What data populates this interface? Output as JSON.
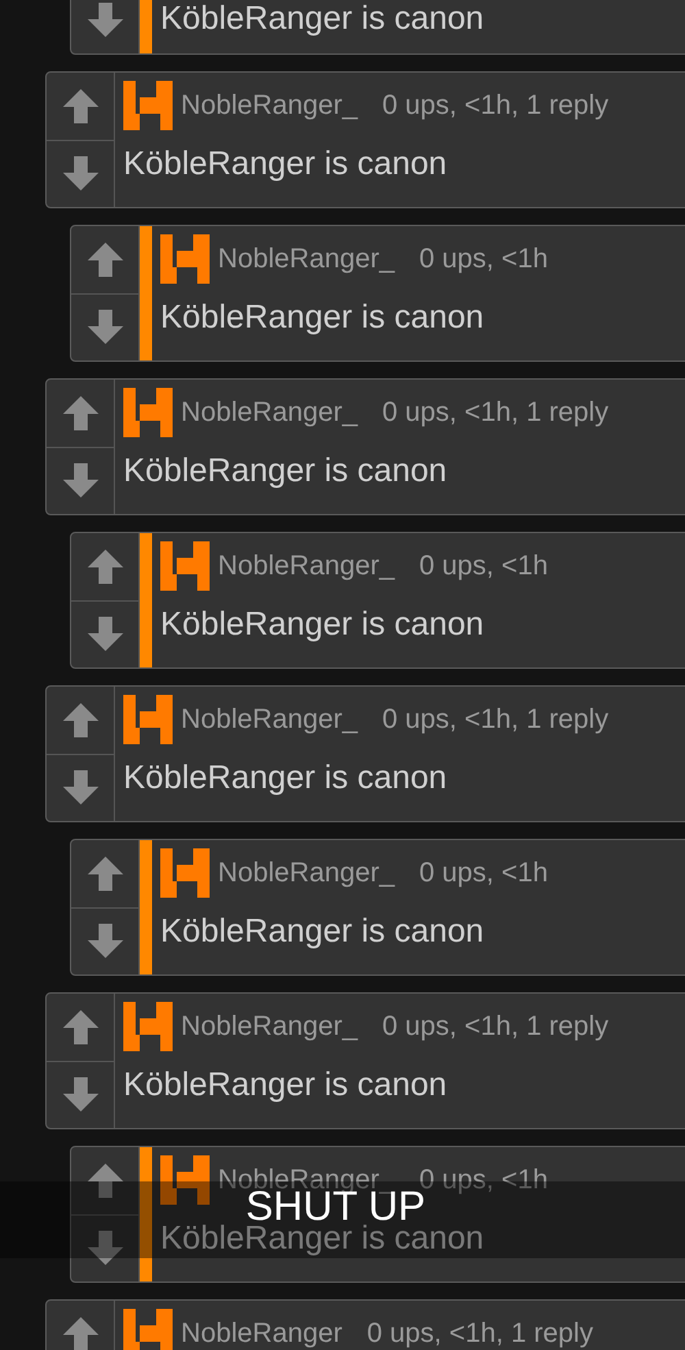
{
  "comments": [
    {
      "kind": "reply",
      "text": "KöbleRanger is canon"
    },
    {
      "kind": "root",
      "author": "NobleRanger_",
      "meta": "0 ups, <1h, 1 reply",
      "text": "KöbleRanger is canon"
    },
    {
      "kind": "reply",
      "author": "NobleRanger_",
      "meta": "0 ups, <1h",
      "text": "KöbleRanger is canon"
    },
    {
      "kind": "root",
      "author": "NobleRanger_",
      "meta": "0 ups, <1h, 1 reply",
      "text": "KöbleRanger is canon"
    },
    {
      "kind": "reply",
      "author": "NobleRanger_",
      "meta": "0 ups, <1h",
      "text": "KöbleRanger is canon"
    },
    {
      "kind": "root",
      "author": "NobleRanger_",
      "meta": "0 ups, <1h, 1 reply",
      "text": "KöbleRanger is canon"
    },
    {
      "kind": "reply",
      "author": "NobleRanger_",
      "meta": "0 ups, <1h",
      "text": "KöbleRanger is canon"
    },
    {
      "kind": "root",
      "author": "NobleRanger_",
      "meta": "0 ups, <1h, 1 reply",
      "text": "KöbleRanger is canon"
    },
    {
      "kind": "reply",
      "author": "NobleRanger_",
      "meta": "0 ups, <1h",
      "text": "KöbleRanger is canon"
    },
    {
      "kind": "root",
      "author": "NobleRanger",
      "meta": "0 ups, <1h, 1 reply"
    }
  ],
  "caption": "SHUT UP"
}
